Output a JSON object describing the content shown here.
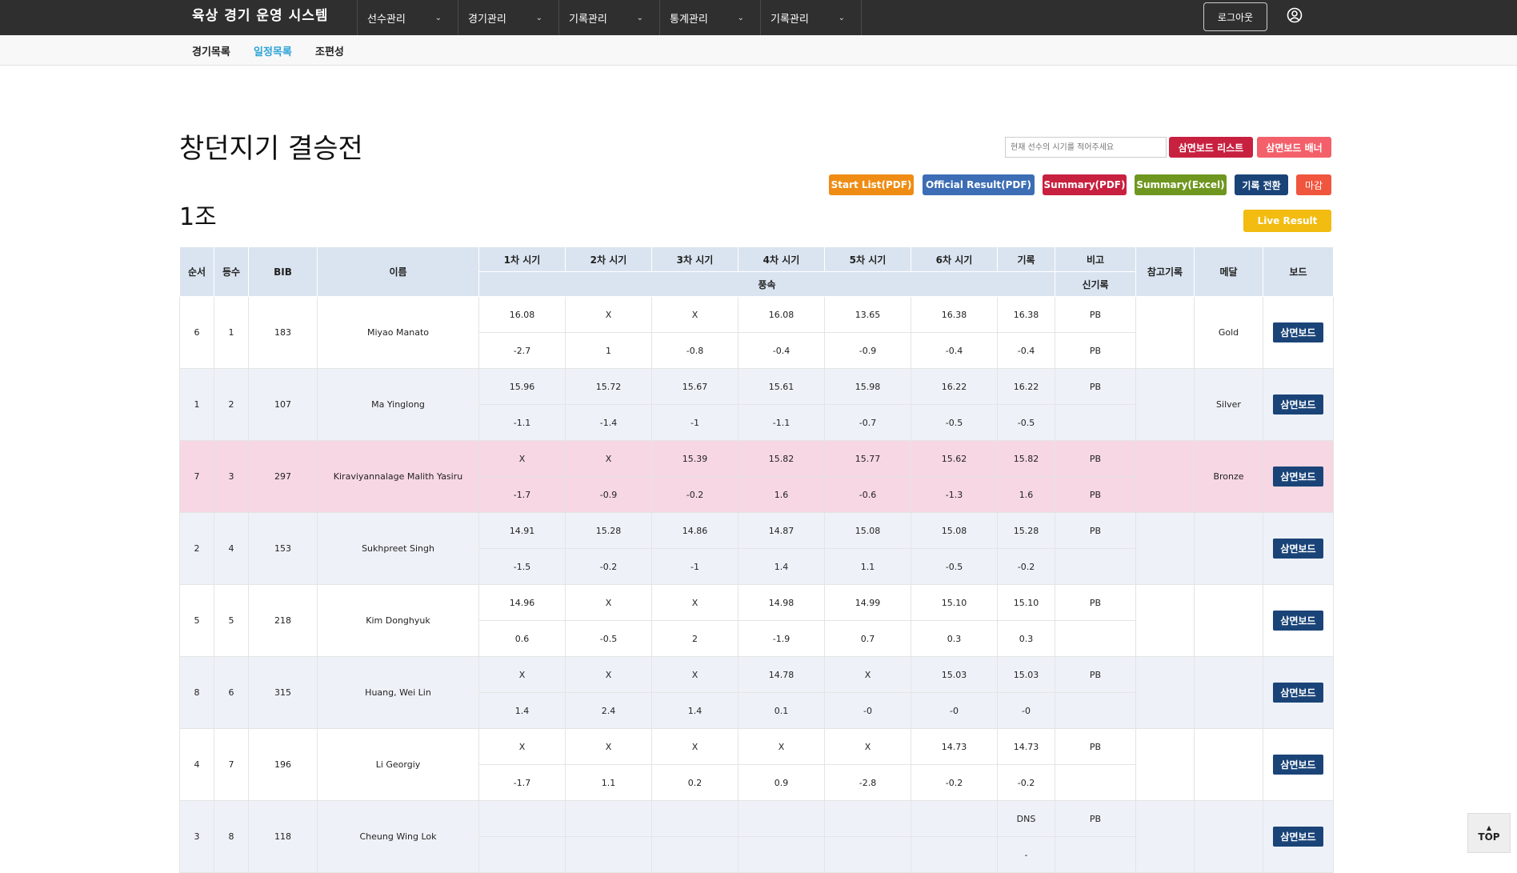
{
  "header": {
    "brand": "육상 경기 운영 시스템",
    "menus": [
      "선수관리",
      "경기관리",
      "기록관리",
      "통계관리",
      "기록관리"
    ],
    "logout": "로그아웃"
  },
  "subnav": {
    "items": [
      "경기목록",
      "일정목록",
      "조편성"
    ],
    "active": "일정목록"
  },
  "page": {
    "title": "창던지기 결승전",
    "group": "1조"
  },
  "search": {
    "placeholder": "현재 선수의 시기를 적어주세요"
  },
  "buttons": {
    "scoreboard_list": "삼면보드 리스트",
    "scoreboard_banner": "삼면보드 배너",
    "start_list": "Start List(PDF)",
    "official_result": "Official Result(PDF)",
    "summary_pdf": "Summary(PDF)",
    "summary_excel": "Summary(Excel)",
    "record_switch": "기록 전환",
    "close": "마감",
    "live_result": "Live Result"
  },
  "colors": {
    "topbar": "#2f2f2f",
    "scoreboard_list": "#c8203f",
    "scoreboard_banner": "#f4606a",
    "start_list": "#ef8c14",
    "official_result": "#3c6db5",
    "summary_pdf": "#c8203f",
    "summary_excel": "#6f9720",
    "record_switch": "#1a4478",
    "close": "#f0553e",
    "live_result": "#f2bc10",
    "header_cell": "#dae4f0",
    "highlight_row": "#f7d7e3"
  },
  "table": {
    "headers": {
      "order": "순서",
      "rank": "등수",
      "bib": "BIB",
      "name": "이름",
      "attempts": [
        "1차 시기",
        "2차 시기",
        "3차 시기",
        "4차 시기",
        "5차 시기",
        "6차 시기"
      ],
      "record": "기록",
      "remark": "비고",
      "wind": "풍속",
      "new_record": "신기록",
      "ref_record": "참고기록",
      "medal": "메달",
      "board": "보드"
    },
    "board_label": "삼면보드",
    "rows": [
      {
        "order": "6",
        "rank": "1",
        "bib": "183",
        "name": "Miyao Manato",
        "attempts": [
          "16.08",
          "X",
          "X",
          "16.08",
          "13.65",
          "16.38"
        ],
        "record": "16.38",
        "remark": "PB",
        "winds": [
          "-2.7",
          "1",
          "-0.8",
          "-0.4",
          "-0.9",
          "-0.4"
        ],
        "wind_record": "-0.4",
        "new_record": "PB",
        "ref": "",
        "medal": "Gold",
        "style": "row-white"
      },
      {
        "order": "1",
        "rank": "2",
        "bib": "107",
        "name": "Ma Yinglong",
        "attempts": [
          "15.96",
          "15.72",
          "15.67",
          "15.61",
          "15.98",
          "16.22"
        ],
        "record": "16.22",
        "remark": "PB",
        "winds": [
          "-1.1",
          "-1.4",
          "-1",
          "-1.1",
          "-0.7",
          "-0.5"
        ],
        "wind_record": "-0.5",
        "new_record": "",
        "ref": "",
        "medal": "Silver",
        "style": "row-blue"
      },
      {
        "order": "7",
        "rank": "3",
        "bib": "297",
        "name": "Kiraviyannalage Malith Yasiru",
        "attempts": [
          "X",
          "X",
          "15.39",
          "15.82",
          "15.77",
          "15.62"
        ],
        "record": "15.82",
        "remark": "PB",
        "winds": [
          "-1.7",
          "-0.9",
          "-0.2",
          "1.6",
          "-0.6",
          "-1.3"
        ],
        "wind_record": "1.6",
        "new_record": "PB",
        "ref": "",
        "medal": "Bronze",
        "style": "row-pink"
      },
      {
        "order": "2",
        "rank": "4",
        "bib": "153",
        "name": "Sukhpreet Singh",
        "attempts": [
          "14.91",
          "15.28",
          "14.86",
          "14.87",
          "15.08",
          "15.08"
        ],
        "record": "15.28",
        "remark": "PB",
        "winds": [
          "-1.5",
          "-0.2",
          "-1",
          "1.4",
          "1.1",
          "-0.5"
        ],
        "wind_record": "-0.2",
        "new_record": "",
        "ref": "",
        "medal": "",
        "style": "row-blue"
      },
      {
        "order": "5",
        "rank": "5",
        "bib": "218",
        "name": "Kim Donghyuk",
        "attempts": [
          "14.96",
          "X",
          "X",
          "14.98",
          "14.99",
          "15.10"
        ],
        "record": "15.10",
        "remark": "PB",
        "winds": [
          "0.6",
          "-0.5",
          "2",
          "-1.9",
          "0.7",
          "0.3"
        ],
        "wind_record": "0.3",
        "new_record": "",
        "ref": "",
        "medal": "",
        "style": "row-white"
      },
      {
        "order": "8",
        "rank": "6",
        "bib": "315",
        "name": "Huang, Wei Lin",
        "attempts": [
          "X",
          "X",
          "X",
          "14.78",
          "X",
          "15.03"
        ],
        "record": "15.03",
        "remark": "PB",
        "winds": [
          "1.4",
          "2.4",
          "1.4",
          "0.1",
          "-0",
          "-0"
        ],
        "wind_record": "-0",
        "new_record": "",
        "ref": "",
        "medal": "",
        "style": "row-blue"
      },
      {
        "order": "4",
        "rank": "7",
        "bib": "196",
        "name": "Li Georgiy",
        "attempts": [
          "X",
          "X",
          "X",
          "X",
          "X",
          "14.73"
        ],
        "record": "14.73",
        "remark": "PB",
        "winds": [
          "-1.7",
          "1.1",
          "0.2",
          "0.9",
          "-2.8",
          "-0.2"
        ],
        "wind_record": "-0.2",
        "new_record": "",
        "ref": "",
        "medal": "",
        "style": "row-white"
      },
      {
        "order": "3",
        "rank": "8",
        "bib": "118",
        "name": "Cheung Wing Lok",
        "attempts": [
          "",
          "",
          "",
          "",
          "",
          ""
        ],
        "record": "DNS",
        "remark": "PB",
        "winds": [
          "",
          "",
          "",
          "",
          "",
          ""
        ],
        "wind_record": "-",
        "new_record": "",
        "ref": "",
        "medal": "",
        "style": "row-blue"
      }
    ]
  },
  "top_button": "TOP"
}
